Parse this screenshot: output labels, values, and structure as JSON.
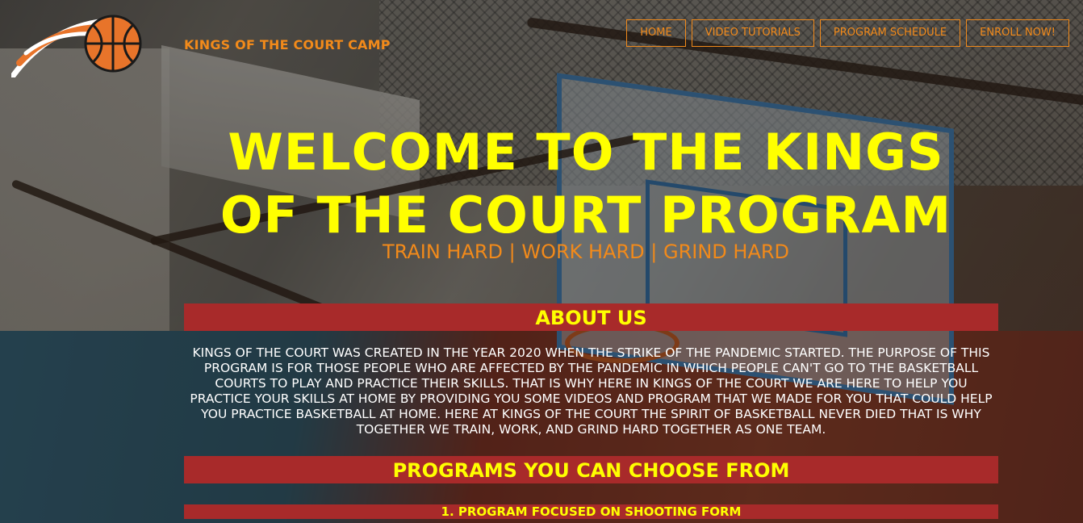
{
  "brand": {
    "logo_icon": "basketball-logo-icon",
    "name": "KINGS OF THE COURT CAMP"
  },
  "nav": {
    "items": [
      {
        "label": "HOME"
      },
      {
        "label": "VIDEO TUTORIALS"
      },
      {
        "label": "PROGRAM SCHEDULE"
      },
      {
        "label": "ENROLL NOW!"
      }
    ]
  },
  "hero": {
    "title": "WELCOME TO THE KINGS OF THE COURT PROGRAM",
    "tagline": "TRAIN HARD | WORK HARD | GRIND HARD"
  },
  "about": {
    "heading": "ABOUT US",
    "text": "KINGS OF THE COURT WAS CREATED IN THE YEAR 2020 WHEN THE STRIKE OF THE PANDEMIC STARTED. THE PURPOSE OF THIS PROGRAM IS FOR THOSE PEOPLE WHO ARE AFFECTED BY THE PANDEMIC IN WHICH PEOPLE CAN'T GO TO THE BASKETBALL COURTS TO PLAY AND PRACTICE THEIR SKILLS. THAT IS WHY HERE IN KINGS OF THE COURT WE ARE HERE TO HELP YOU PRACTICE YOUR SKILLS AT HOME BY PROVIDING YOU SOME VIDEOS AND PROGRAM THAT WE MADE FOR YOU THAT COULD HELP YOU PRACTICE BASKETBALL AT HOME. HERE AT KINGS OF THE COURT THE SPIRIT OF BASKETBALL NEVER DIED THAT IS WHY TOGETHER WE TRAIN, WORK, AND GRIND HARD TOGETHER AS ONE TEAM."
  },
  "programs": {
    "heading": "PROGRAMS YOU CAN CHOOSE FROM",
    "items": [
      {
        "label": "1. PROGRAM FOCUSED ON SHOOTING FORM"
      }
    ]
  },
  "colors": {
    "accent_orange": "#f28a1a",
    "title_yellow": "#ffff00",
    "section_red": "#a82a2a"
  }
}
